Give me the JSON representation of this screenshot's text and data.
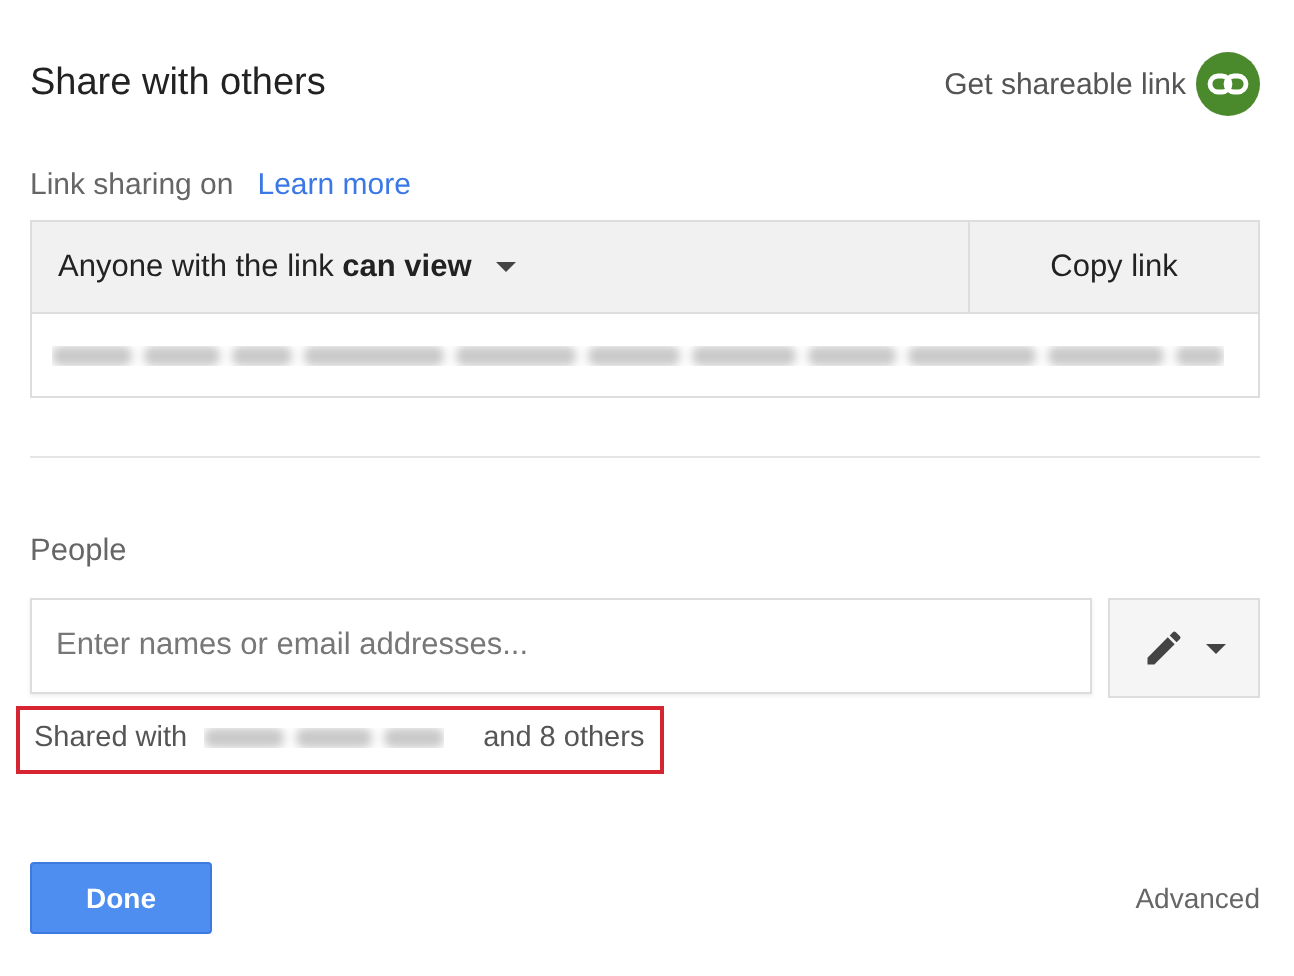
{
  "dialog": {
    "title": "Share with others",
    "shareable_link": {
      "label": "Get shareable link"
    }
  },
  "link_sharing": {
    "label": "Link sharing on",
    "learn_more": "Learn more",
    "access": "Anyone with the link **can view**",
    "copy_button": "Copy link"
  },
  "people": {
    "label": "People",
    "placeholder": "Enter names or email addresses...",
    "shared_prefix": "Shared with",
    "shared_suffix": "and 8 others"
  },
  "buttons": {
    "done": "Done",
    "advanced": "Advanced"
  }
}
